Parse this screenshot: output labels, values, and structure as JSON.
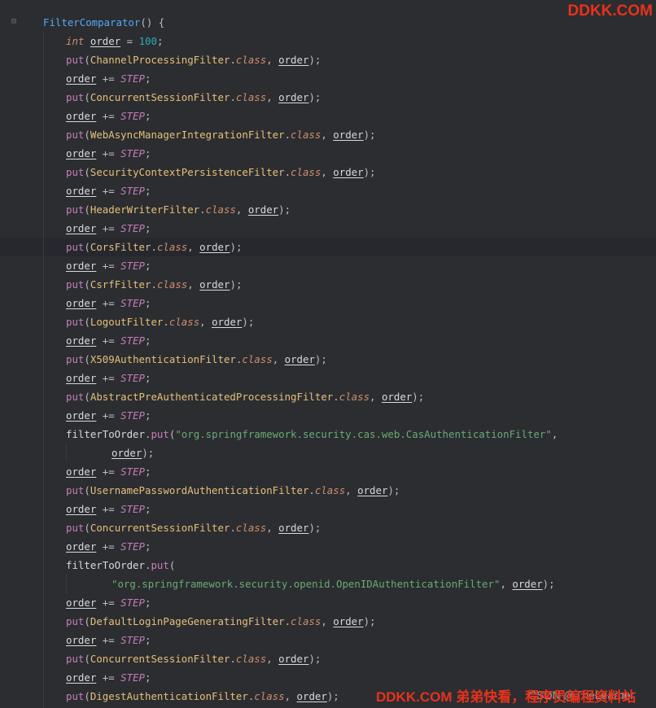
{
  "editor": {
    "fold_icon": "fold-minus-icon",
    "lines": [
      [
        {
          "t": "FilterComparator",
          "c": "fn"
        },
        {
          "t": "() {",
          "c": "punct"
        }
      ],
      [
        {
          "t": "int",
          "c": "kw"
        },
        {
          "t": " ",
          "c": "punct"
        },
        {
          "t": "order",
          "c": "var"
        },
        {
          "t": " = ",
          "c": "punct"
        },
        {
          "t": "100",
          "c": "num"
        },
        {
          "t": ";",
          "c": "punct"
        }
      ],
      [
        {
          "t": "put",
          "c": "meth"
        },
        {
          "t": "(",
          "c": "punct"
        },
        {
          "t": "ChannelProcessingFilter",
          "c": "cls"
        },
        {
          "t": ".",
          "c": "punct"
        },
        {
          "t": "class",
          "c": "classkw"
        },
        {
          "t": ", ",
          "c": "punct"
        },
        {
          "t": "order",
          "c": "var"
        },
        {
          "t": ");",
          "c": "punct"
        }
      ],
      [
        {
          "t": "order",
          "c": "var"
        },
        {
          "t": " += ",
          "c": "punct"
        },
        {
          "t": "STEP",
          "c": "stat"
        },
        {
          "t": ";",
          "c": "punct"
        }
      ],
      [
        {
          "t": "put",
          "c": "meth"
        },
        {
          "t": "(",
          "c": "punct"
        },
        {
          "t": "ConcurrentSessionFilter",
          "c": "cls"
        },
        {
          "t": ".",
          "c": "punct"
        },
        {
          "t": "class",
          "c": "classkw"
        },
        {
          "t": ", ",
          "c": "punct"
        },
        {
          "t": "order",
          "c": "var"
        },
        {
          "t": ");",
          "c": "punct"
        }
      ],
      [
        {
          "t": "order",
          "c": "var"
        },
        {
          "t": " += ",
          "c": "punct"
        },
        {
          "t": "STEP",
          "c": "stat"
        },
        {
          "t": ";",
          "c": "punct"
        }
      ],
      [
        {
          "t": "put",
          "c": "meth"
        },
        {
          "t": "(",
          "c": "punct"
        },
        {
          "t": "WebAsyncManagerIntegrationFilter",
          "c": "cls"
        },
        {
          "t": ".",
          "c": "punct"
        },
        {
          "t": "class",
          "c": "classkw"
        },
        {
          "t": ", ",
          "c": "punct"
        },
        {
          "t": "order",
          "c": "var"
        },
        {
          "t": ");",
          "c": "punct"
        }
      ],
      [
        {
          "t": "order",
          "c": "var"
        },
        {
          "t": " += ",
          "c": "punct"
        },
        {
          "t": "STEP",
          "c": "stat"
        },
        {
          "t": ";",
          "c": "punct"
        }
      ],
      [
        {
          "t": "put",
          "c": "meth"
        },
        {
          "t": "(",
          "c": "punct"
        },
        {
          "t": "SecurityContextPersistenceFilter",
          "c": "cls"
        },
        {
          "t": ".",
          "c": "punct"
        },
        {
          "t": "class",
          "c": "classkw"
        },
        {
          "t": ", ",
          "c": "punct"
        },
        {
          "t": "order",
          "c": "var"
        },
        {
          "t": ");",
          "c": "punct"
        }
      ],
      [
        {
          "t": "order",
          "c": "var"
        },
        {
          "t": " += ",
          "c": "punct"
        },
        {
          "t": "STEP",
          "c": "stat"
        },
        {
          "t": ";",
          "c": "punct"
        }
      ],
      [
        {
          "t": "put",
          "c": "meth"
        },
        {
          "t": "(",
          "c": "punct"
        },
        {
          "t": "HeaderWriterFilter",
          "c": "cls"
        },
        {
          "t": ".",
          "c": "punct"
        },
        {
          "t": "class",
          "c": "classkw"
        },
        {
          "t": ", ",
          "c": "punct"
        },
        {
          "t": "order",
          "c": "var"
        },
        {
          "t": ");",
          "c": "punct"
        }
      ],
      [
        {
          "t": "order",
          "c": "var"
        },
        {
          "t": " += ",
          "c": "punct"
        },
        {
          "t": "STEP",
          "c": "stat"
        },
        {
          "t": ";",
          "c": "punct"
        }
      ],
      [
        {
          "t": "put",
          "c": "meth"
        },
        {
          "t": "(",
          "c": "punct"
        },
        {
          "t": "CorsFilter",
          "c": "cls"
        },
        {
          "t": ".",
          "c": "punct"
        },
        {
          "t": "class",
          "c": "classkw"
        },
        {
          "t": ", ",
          "c": "punct"
        },
        {
          "t": "order",
          "c": "var"
        },
        {
          "t": ");",
          "c": "punct"
        }
      ],
      [
        {
          "t": "order",
          "c": "var"
        },
        {
          "t": " += ",
          "c": "punct"
        },
        {
          "t": "STEP",
          "c": "stat"
        },
        {
          "t": ";",
          "c": "punct"
        }
      ],
      [
        {
          "t": "put",
          "c": "meth"
        },
        {
          "t": "(",
          "c": "punct"
        },
        {
          "t": "CsrfFilter",
          "c": "cls"
        },
        {
          "t": ".",
          "c": "punct"
        },
        {
          "t": "class",
          "c": "classkw"
        },
        {
          "t": ", ",
          "c": "punct"
        },
        {
          "t": "order",
          "c": "var"
        },
        {
          "t": ");",
          "c": "punct"
        }
      ],
      [
        {
          "t": "order",
          "c": "var"
        },
        {
          "t": " += ",
          "c": "punct"
        },
        {
          "t": "STEP",
          "c": "stat"
        },
        {
          "t": ";",
          "c": "punct"
        }
      ],
      [
        {
          "t": "put",
          "c": "meth"
        },
        {
          "t": "(",
          "c": "punct"
        },
        {
          "t": "LogoutFilter",
          "c": "cls"
        },
        {
          "t": ".",
          "c": "punct"
        },
        {
          "t": "class",
          "c": "classkw"
        },
        {
          "t": ", ",
          "c": "punct"
        },
        {
          "t": "order",
          "c": "var"
        },
        {
          "t": ");",
          "c": "punct"
        }
      ],
      [
        {
          "t": "order",
          "c": "var"
        },
        {
          "t": " += ",
          "c": "punct"
        },
        {
          "t": "STEP",
          "c": "stat"
        },
        {
          "t": ";",
          "c": "punct"
        }
      ],
      [
        {
          "t": "put",
          "c": "meth"
        },
        {
          "t": "(",
          "c": "punct"
        },
        {
          "t": "X509AuthenticationFilter",
          "c": "cls"
        },
        {
          "t": ".",
          "c": "punct"
        },
        {
          "t": "class",
          "c": "classkw"
        },
        {
          "t": ", ",
          "c": "punct"
        },
        {
          "t": "order",
          "c": "var"
        },
        {
          "t": ");",
          "c": "punct"
        }
      ],
      [
        {
          "t": "order",
          "c": "var"
        },
        {
          "t": " += ",
          "c": "punct"
        },
        {
          "t": "STEP",
          "c": "stat"
        },
        {
          "t": ";",
          "c": "punct"
        }
      ],
      [
        {
          "t": "put",
          "c": "meth"
        },
        {
          "t": "(",
          "c": "punct"
        },
        {
          "t": "AbstractPreAuthenticatedProcessingFilter",
          "c": "cls"
        },
        {
          "t": ".",
          "c": "punct"
        },
        {
          "t": "class",
          "c": "classkw"
        },
        {
          "t": ", ",
          "c": "punct"
        },
        {
          "t": "order",
          "c": "var"
        },
        {
          "t": ");",
          "c": "punct"
        }
      ],
      [
        {
          "t": "order",
          "c": "var"
        },
        {
          "t": " += ",
          "c": "punct"
        },
        {
          "t": "STEP",
          "c": "stat"
        },
        {
          "t": ";",
          "c": "punct"
        }
      ],
      [
        {
          "t": "filterToOrder",
          "c": "plain"
        },
        {
          "t": ".",
          "c": "punct"
        },
        {
          "t": "put",
          "c": "meth"
        },
        {
          "t": "(",
          "c": "punct"
        },
        {
          "t": "\"org.springframework.security.cas.web.CasAuthenticationFilter\"",
          "c": "str"
        },
        {
          "t": ",",
          "c": "punct"
        }
      ],
      [
        {
          "t": "order",
          "c": "var"
        },
        {
          "t": ");",
          "c": "punct"
        }
      ],
      [
        {
          "t": "order",
          "c": "var"
        },
        {
          "t": " += ",
          "c": "punct"
        },
        {
          "t": "STEP",
          "c": "stat"
        },
        {
          "t": ";",
          "c": "punct"
        }
      ],
      [
        {
          "t": "put",
          "c": "meth"
        },
        {
          "t": "(",
          "c": "punct"
        },
        {
          "t": "UsernamePasswordAuthenticationFilter",
          "c": "cls"
        },
        {
          "t": ".",
          "c": "punct"
        },
        {
          "t": "class",
          "c": "classkw"
        },
        {
          "t": ", ",
          "c": "punct"
        },
        {
          "t": "order",
          "c": "var"
        },
        {
          "t": ");",
          "c": "punct"
        }
      ],
      [
        {
          "t": "order",
          "c": "var"
        },
        {
          "t": " += ",
          "c": "punct"
        },
        {
          "t": "STEP",
          "c": "stat"
        },
        {
          "t": ";",
          "c": "punct"
        }
      ],
      [
        {
          "t": "put",
          "c": "meth"
        },
        {
          "t": "(",
          "c": "punct"
        },
        {
          "t": "ConcurrentSessionFilter",
          "c": "cls"
        },
        {
          "t": ".",
          "c": "punct"
        },
        {
          "t": "class",
          "c": "classkw"
        },
        {
          "t": ", ",
          "c": "punct"
        },
        {
          "t": "order",
          "c": "var"
        },
        {
          "t": ");",
          "c": "punct"
        }
      ],
      [
        {
          "t": "order",
          "c": "var"
        },
        {
          "t": " += ",
          "c": "punct"
        },
        {
          "t": "STEP",
          "c": "stat"
        },
        {
          "t": ";",
          "c": "punct"
        }
      ],
      [
        {
          "t": "filterToOrder",
          "c": "plain"
        },
        {
          "t": ".",
          "c": "punct"
        },
        {
          "t": "put",
          "c": "meth"
        },
        {
          "t": "(",
          "c": "punct"
        }
      ],
      [
        {
          "t": "\"org.springframework.security.openid.OpenIDAuthenticationFilter\"",
          "c": "str"
        },
        {
          "t": ", ",
          "c": "punct"
        },
        {
          "t": "order",
          "c": "var"
        },
        {
          "t": ");",
          "c": "punct"
        }
      ],
      [
        {
          "t": "order",
          "c": "var"
        },
        {
          "t": " += ",
          "c": "punct"
        },
        {
          "t": "STEP",
          "c": "stat"
        },
        {
          "t": ";",
          "c": "punct"
        }
      ],
      [
        {
          "t": "put",
          "c": "meth"
        },
        {
          "t": "(",
          "c": "punct"
        },
        {
          "t": "DefaultLoginPageGeneratingFilter",
          "c": "cls"
        },
        {
          "t": ".",
          "c": "punct"
        },
        {
          "t": "class",
          "c": "classkw"
        },
        {
          "t": ", ",
          "c": "punct"
        },
        {
          "t": "order",
          "c": "var"
        },
        {
          "t": ");",
          "c": "punct"
        }
      ],
      [
        {
          "t": "order",
          "c": "var"
        },
        {
          "t": " += ",
          "c": "punct"
        },
        {
          "t": "STEP",
          "c": "stat"
        },
        {
          "t": ";",
          "c": "punct"
        }
      ],
      [
        {
          "t": "put",
          "c": "meth"
        },
        {
          "t": "(",
          "c": "punct"
        },
        {
          "t": "ConcurrentSessionFilter",
          "c": "cls"
        },
        {
          "t": ".",
          "c": "punct"
        },
        {
          "t": "class",
          "c": "classkw"
        },
        {
          "t": ", ",
          "c": "punct"
        },
        {
          "t": "order",
          "c": "var"
        },
        {
          "t": ");",
          "c": "punct"
        }
      ],
      [
        {
          "t": "order",
          "c": "var"
        },
        {
          "t": " += ",
          "c": "punct"
        },
        {
          "t": "STEP",
          "c": "stat"
        },
        {
          "t": ";",
          "c": "punct"
        }
      ],
      [
        {
          "t": "put",
          "c": "meth"
        },
        {
          "t": "(",
          "c": "punct"
        },
        {
          "t": "DigestAuthenticationFilter",
          "c": "cls"
        },
        {
          "t": ".",
          "c": "punct"
        },
        {
          "t": "class",
          "c": "classkw"
        },
        {
          "t": ", ",
          "c": "punct"
        },
        {
          "t": "order",
          "c": "var"
        },
        {
          "t": ");",
          "c": "punct"
        }
      ]
    ]
  },
  "watermarks": {
    "top": "DDKK.COM",
    "bottom_csdn": "CSDN @TheLearner",
    "bottom": "DDKK.COM 弟弟快看，程序员编程资料站"
  },
  "colors": {
    "background": "#2b2d30",
    "current_line": "#26282e",
    "watermark": "#e8321c"
  }
}
